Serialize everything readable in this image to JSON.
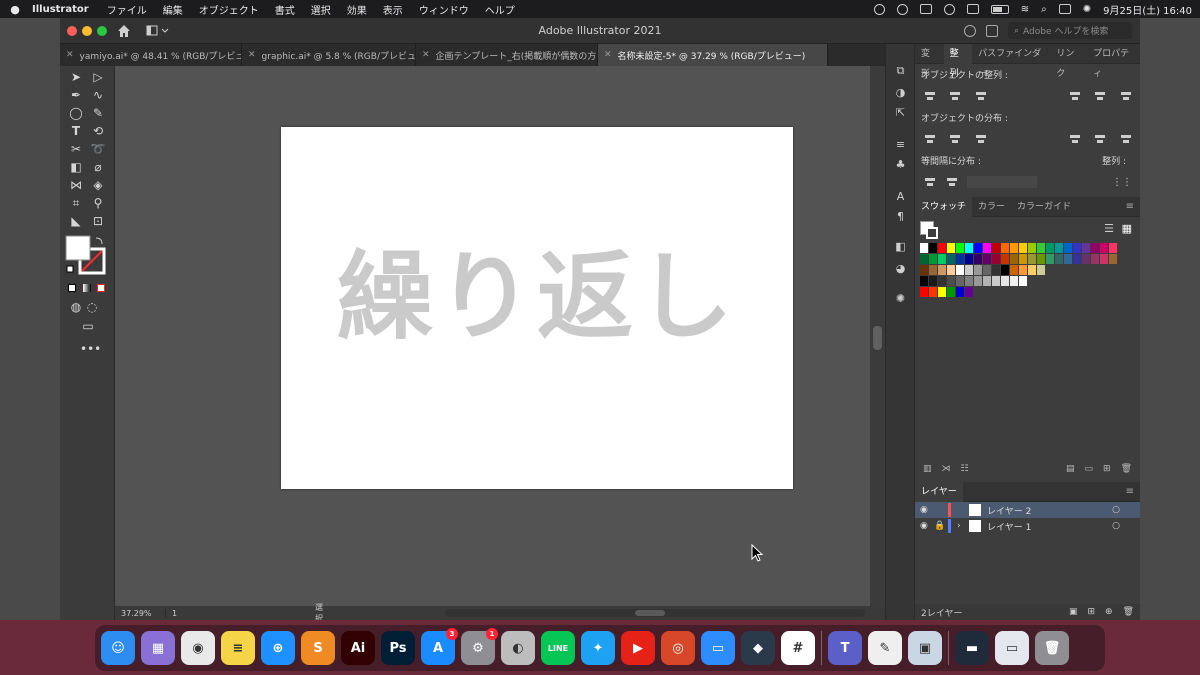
{
  "menubar": {
    "app_name": "Illustrator",
    "items": [
      "ファイル",
      "編集",
      "オブジェクト",
      "書式",
      "選択",
      "効果",
      "表示",
      "ウィンドウ",
      "ヘルプ"
    ],
    "datetime": "9月25日(土)  16:40"
  },
  "window": {
    "title": "Adobe Illustrator 2021",
    "search_placeholder": "Adobe ヘルプを検索"
  },
  "tabs": [
    {
      "label": "yamiyo.ai* @ 48.41 % (RGB/プレビュ...",
      "active": false
    },
    {
      "label": "graphic.ai* @ 5.8 % (RGB/プレビュ...",
      "active": false
    },
    {
      "label": "企画テンプレート_右(掲載順が偶数の方).ai",
      "active": false
    },
    {
      "label": "名称未設定-5* @ 37.29 % (RGB/プレビュー)",
      "active": true
    }
  ],
  "artboard": {
    "text": "繰り返し",
    "text_color": "#cacaca"
  },
  "status": {
    "zoom": "37.29%",
    "page": "1",
    "mode": "選択"
  },
  "align_panel": {
    "tabs": [
      "変形",
      "整列",
      "パスファインダー",
      "リンク",
      "プロパティ"
    ],
    "active_tab": "整列",
    "align_label": "オブジェクトの整列 :",
    "distribute_label": "オブジェクトの分布 :",
    "spacing_label": "等間隔に分布 :",
    "align_to_label": "整列 :"
  },
  "swatch_panel": {
    "tabs": [
      "スウォッチ",
      "カラー",
      "カラーガイド"
    ],
    "active_tab": "スウォッチ",
    "rows": [
      [
        "#ffffff",
        "#000000",
        "#ff0000",
        "#ffff00",
        "#00ff00",
        "#00ffff",
        "#0000ff",
        "#ff00ff",
        "#c00000",
        "#ff6600",
        "#ff9900",
        "#ffcc00",
        "#99cc00",
        "#33cc33",
        "#009966",
        "#009999",
        "#0066cc",
        "#3333cc",
        "#663399",
        "#990066",
        "#cc0066",
        "#ff3366"
      ],
      [
        "#006633",
        "#009933",
        "#00cc66",
        "#006666",
        "#003399",
        "#000099",
        "#330066",
        "#660066",
        "#990033",
        "#cc3300",
        "#996600",
        "#cc9900",
        "#999933",
        "#669900",
        "#339966",
        "#336666",
        "#336699",
        "#333399",
        "#663366",
        "#993366",
        "#cc3366",
        "#996633"
      ],
      [
        "#663300",
        "#996633",
        "#cc9966",
        "#ffcc99",
        "#ffffff",
        "#cccccc",
        "#999999",
        "#666666",
        "#333333",
        "#000000",
        "#cc6600",
        "#ff9933",
        "#ffcc66",
        "#cccc99"
      ],
      [
        "#000000",
        "#1a1a1a",
        "#333333",
        "#4d4d4d",
        "#666666",
        "#808080",
        "#999999",
        "#b3b3b3",
        "#cccccc",
        "#e6e6e6",
        "#f2f2f2",
        "#ffffff"
      ],
      [
        "#ff0000",
        "#ff3300",
        "#ffff00",
        "#009900",
        "#0000cc",
        "#660099"
      ]
    ]
  },
  "layers_panel": {
    "title": "レイヤー",
    "layers": [
      {
        "name": "レイヤー 2",
        "color": "#ff4f4f",
        "selected": true
      },
      {
        "name": "レイヤー 1",
        "color": "#4f7fff",
        "selected": false
      }
    ],
    "count": "2レイヤー"
  },
  "dock": {
    "apps": [
      {
        "name": "finder",
        "label": "☺",
        "color": "#2d8cf0"
      },
      {
        "name": "launchpad",
        "label": "▦",
        "color": "#8a6fd6"
      },
      {
        "name": "chrome",
        "label": "◉",
        "color": "#e9e9e9"
      },
      {
        "name": "notes",
        "label": "≡",
        "color": "#f5d547"
      },
      {
        "name": "safari",
        "label": "⊕",
        "color": "#1e90ff"
      },
      {
        "name": "sublime",
        "label": "S",
        "color": "#f08a24"
      },
      {
        "name": "illustrator",
        "label": "Ai",
        "color": "#330000"
      },
      {
        "name": "photoshop",
        "label": "Ps",
        "color": "#001e36"
      },
      {
        "name": "app-store",
        "label": "A",
        "color": "#1a8cff",
        "badge": "3"
      },
      {
        "name": "system-preferences",
        "label": "⚙",
        "color": "#8e8e93",
        "badge": "1"
      },
      {
        "name": "mastodon",
        "label": "◐",
        "color": "#bdbdbd"
      },
      {
        "name": "line",
        "label": "LINE",
        "color": "#06c755"
      },
      {
        "name": "twitter",
        "label": "✦",
        "color": "#1da1f2"
      },
      {
        "name": "youtube",
        "label": "▶",
        "color": "#e62117"
      },
      {
        "name": "compass",
        "label": "◎",
        "color": "#d9472b"
      },
      {
        "name": "zoom",
        "label": "▭",
        "color": "#2d8cff"
      },
      {
        "name": "app-dark",
        "label": "◆",
        "color": "#2b3a4a"
      },
      {
        "name": "slack",
        "label": "#",
        "color": "#ffffff"
      },
      {
        "name": "teams",
        "label": "T",
        "color": "#5b5fc7"
      },
      {
        "name": "textedit",
        "label": "✎",
        "color": "#efefef"
      },
      {
        "name": "preview",
        "label": "▣",
        "color": "#c9d6e3"
      },
      {
        "name": "screenshot-a",
        "label": "▬",
        "color": "#1f2a3a"
      },
      {
        "name": "screenshot-b",
        "label": "▭",
        "color": "#e4e8ee"
      },
      {
        "name": "trash",
        "label": "🗑",
        "color": "#8e8e93"
      }
    ]
  }
}
